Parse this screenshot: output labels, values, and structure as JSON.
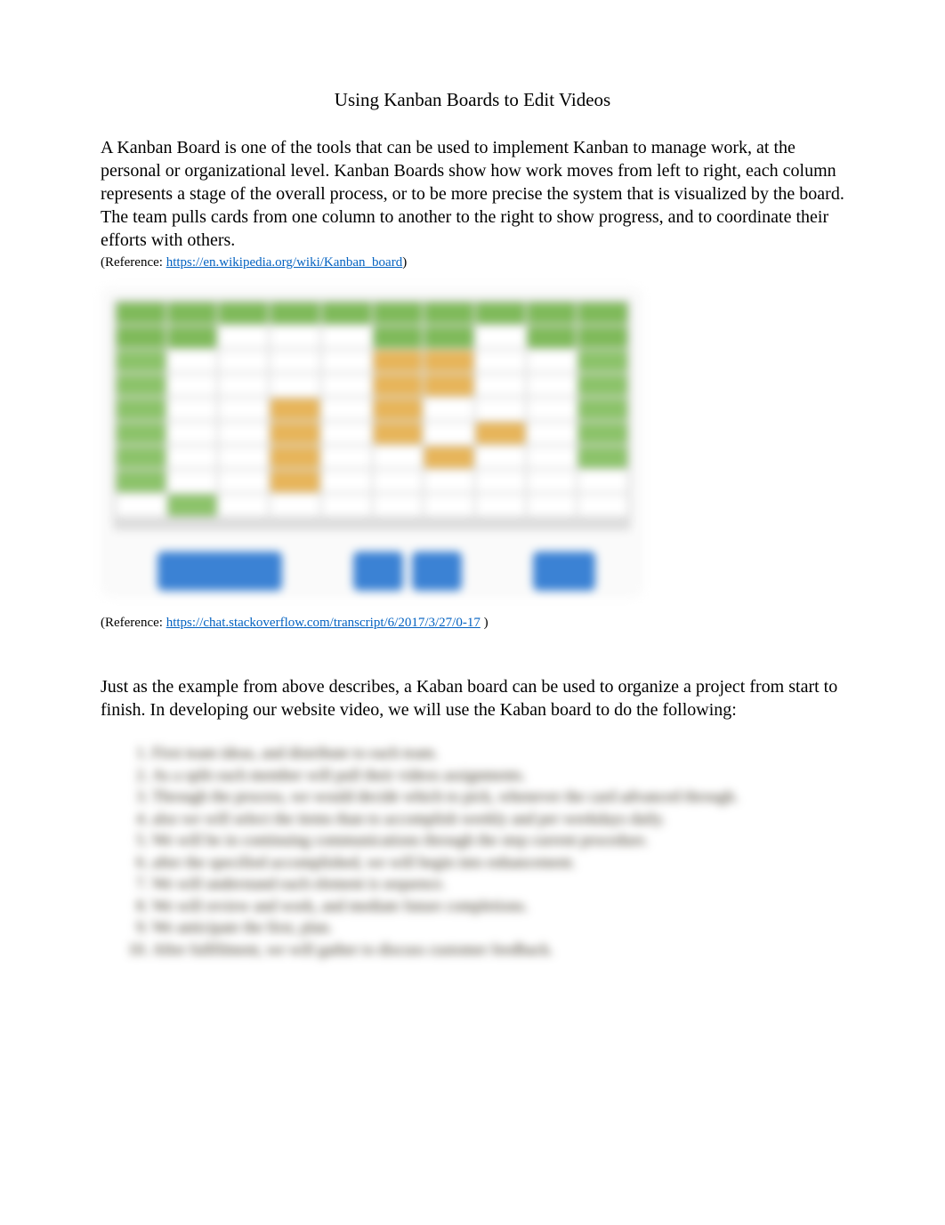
{
  "title": "Using Kanban Boards to Edit Videos",
  "intro": "A Kanban Board is one of the tools that can be used to implement Kanban to manage work, at the personal or organizational level.  Kanban Boards show how work moves from left to right, each column represents a stage of the overall process, or to be more precise the system that is visualized by the board. The team pulls cards from one column to another to the right to show progress, and to coordinate their efforts with others.",
  "ref1_label": "(Reference: ",
  "ref1_link": "https://en.wikipedia.org/wiki/Kanban_board",
  "ref1_close": ")",
  "ref2_label": "(Reference: ",
  "ref2_link": "https://chat.stackoverflow.com/transcript/6/2017/3/27/0-17",
  "ref2_close": " )",
  "para2": "Just as the example from above describes, a Kaban board can be used to organize a project from start to finish.  In developing our website video, we will use the Kaban board to do the following:",
  "steps": [
    "First team ideas, and distribute to each team.",
    "As a split each member will pull their videos assignments.",
    "Through the process, we would decide which to pick, whenever the card advanced through.",
    "also we will select the items than to accomplish weekly and per weekdays daily.",
    "We will be in continuing communications through the step current procedure.",
    "after the specified accomplished, we will begin into enhancement.",
    "We will understand each element is sequence.",
    "We will review and work, and mediate future completions.",
    "We anticipate the first, plan.",
    "After fullfilment, we will gather to discuss customer feedback."
  ]
}
